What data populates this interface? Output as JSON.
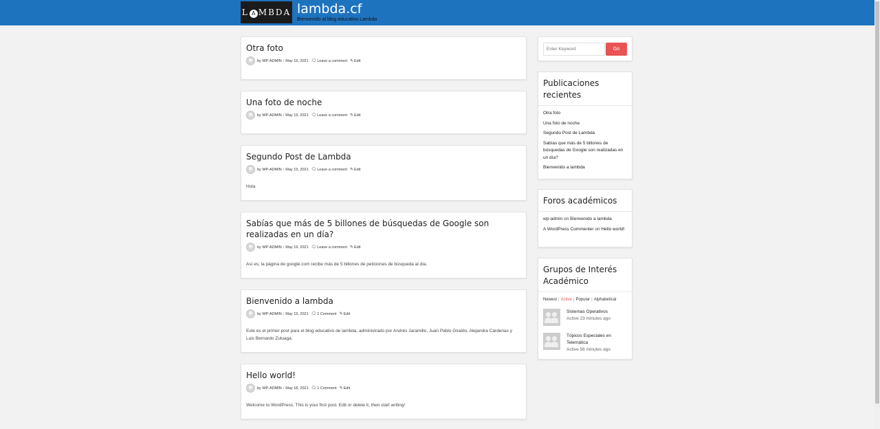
{
  "header": {
    "logo_text_left": "L",
    "logo_text_ring": "A",
    "logo_text_right": "MBDA",
    "title": "lambda.cf",
    "description": "Bienvenido al blog educativo Lambda"
  },
  "posts": [
    {
      "title": "Otra foto",
      "by": "by",
      "author": "WP-ADMIN",
      "date": "May 19, 2021",
      "comments": "Leave a comment",
      "edit": "Edit",
      "excerpt": ""
    },
    {
      "title": "Una foto de noche",
      "by": "by",
      "author": "WP-ADMIN",
      "date": "May 19, 2021",
      "comments": "Leave a comment",
      "edit": "Edit",
      "excerpt": ""
    },
    {
      "title": "Segundo Post de Lambda",
      "by": "by",
      "author": "WP-ADMIN",
      "date": "May 19, 2021",
      "comments": "Leave a comment",
      "edit": "Edit",
      "excerpt": "Hola"
    },
    {
      "title": "Sabías que más de 5 billones de búsquedas de Google son realizadas en un día?",
      "by": "by",
      "author": "WP-ADMIN",
      "date": "May 19, 2021",
      "comments": "Leave a comment",
      "edit": "Edit",
      "excerpt": "Así es, la página de google.com recibe más de 5 billones de peticiones de búsqueda al día."
    },
    {
      "title": "Bienvenido a lambda",
      "by": "by",
      "author": "WP-ADMIN",
      "date": "May 19, 2021",
      "comments": "1 Comment",
      "edit": "Edit",
      "excerpt": "Este es el primer post para el blog educativo de lambda, administrado por Andrés Jaramillo, Juan Pablo Giraldo, Alejandra Cárdenas y Luis Bernardo Zuluaga."
    },
    {
      "title": "Hello world!",
      "by": "by",
      "author": "WP-ADMIN",
      "date": "May 18, 2021",
      "comments": "1 Comment",
      "edit": "Edit",
      "excerpt": "Welcome to WordPress. This is your first post. Edit or delete it, then start writing!"
    }
  ],
  "search": {
    "placeholder": "Enter Keyword",
    "button": "Go"
  },
  "recent": {
    "title": "Publicaciones recientes",
    "items": [
      "Otra foto",
      "Una foto de noche",
      "Segundo Post de Lambda",
      "Sabías que más de 5 billones de búsquedas de Google son realizadas en un día?",
      "Bienvenido a lambda"
    ]
  },
  "forums": {
    "title": "Foros académicos",
    "items": [
      {
        "author": "wp-admin",
        "on": "on",
        "post": "Bienvenido a lambda"
      },
      {
        "author": "A WordPress Commenter",
        "on": "on",
        "post": "Hello world!"
      }
    ]
  },
  "groups": {
    "title": "Grupos de Interés Académico",
    "filters": [
      "Newest",
      "Active",
      "Popular",
      "Alphabetical"
    ],
    "filter_separator": "|",
    "active_filter": "Active",
    "items": [
      {
        "name": "Sistemas Operativos",
        "active": "Active 23 minutes ago"
      },
      {
        "name": "Tópicos Especiales en Telemática",
        "active": "Active 56 minutes ago"
      }
    ]
  },
  "colors": {
    "header": "#1e73be",
    "accent": "#e85454"
  },
  "icons": {
    "comment": "comment-icon",
    "edit": "pencil-icon",
    "avatar": "avatar-icon",
    "group": "group-avatar-icon"
  }
}
